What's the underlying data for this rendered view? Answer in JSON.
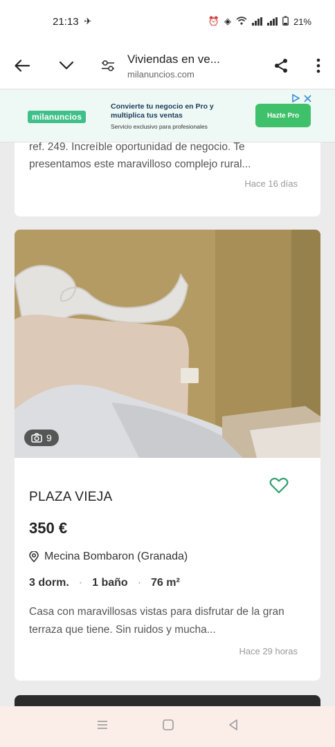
{
  "status_bar": {
    "time": "21:13",
    "battery": "21%"
  },
  "toolbar": {
    "title": "Viviendas en ve...",
    "domain": "milanuncios.com"
  },
  "ad": {
    "logo": "milanuncios",
    "headline": "Convierte tu negocio en Pro y multiplica tus ventas",
    "sub": "Servicio exclusivo para profesionales",
    "button": "Hazte Pro"
  },
  "prev_listing": {
    "text": "ref. 249. Increíble oportunidad de negocio. Te presentamos este maravilloso complejo rural...",
    "time": "Hace 16 días"
  },
  "listing": {
    "photo_count": "9",
    "title": "PLAZA VIEJA",
    "price": "350 €",
    "location": "Mecina Bombaron (Granada)",
    "features": [
      "3 dorm.",
      "1 baño",
      "76 m²"
    ],
    "description": "Casa con maravillosas vistas para disfrutar de la gran terraza que tiene. Sin ruidos y mucha...",
    "time": "Hace 29 horas"
  },
  "colors": {
    "accent": "#2f9e6e",
    "ad_button": "#3fc06a"
  },
  "icons": [
    "back-arrow-icon",
    "chevron-down-icon",
    "page-settings-icon",
    "share-icon",
    "more-vert-icon",
    "camera-icon",
    "heart-outline-icon",
    "location-pin-icon"
  ]
}
